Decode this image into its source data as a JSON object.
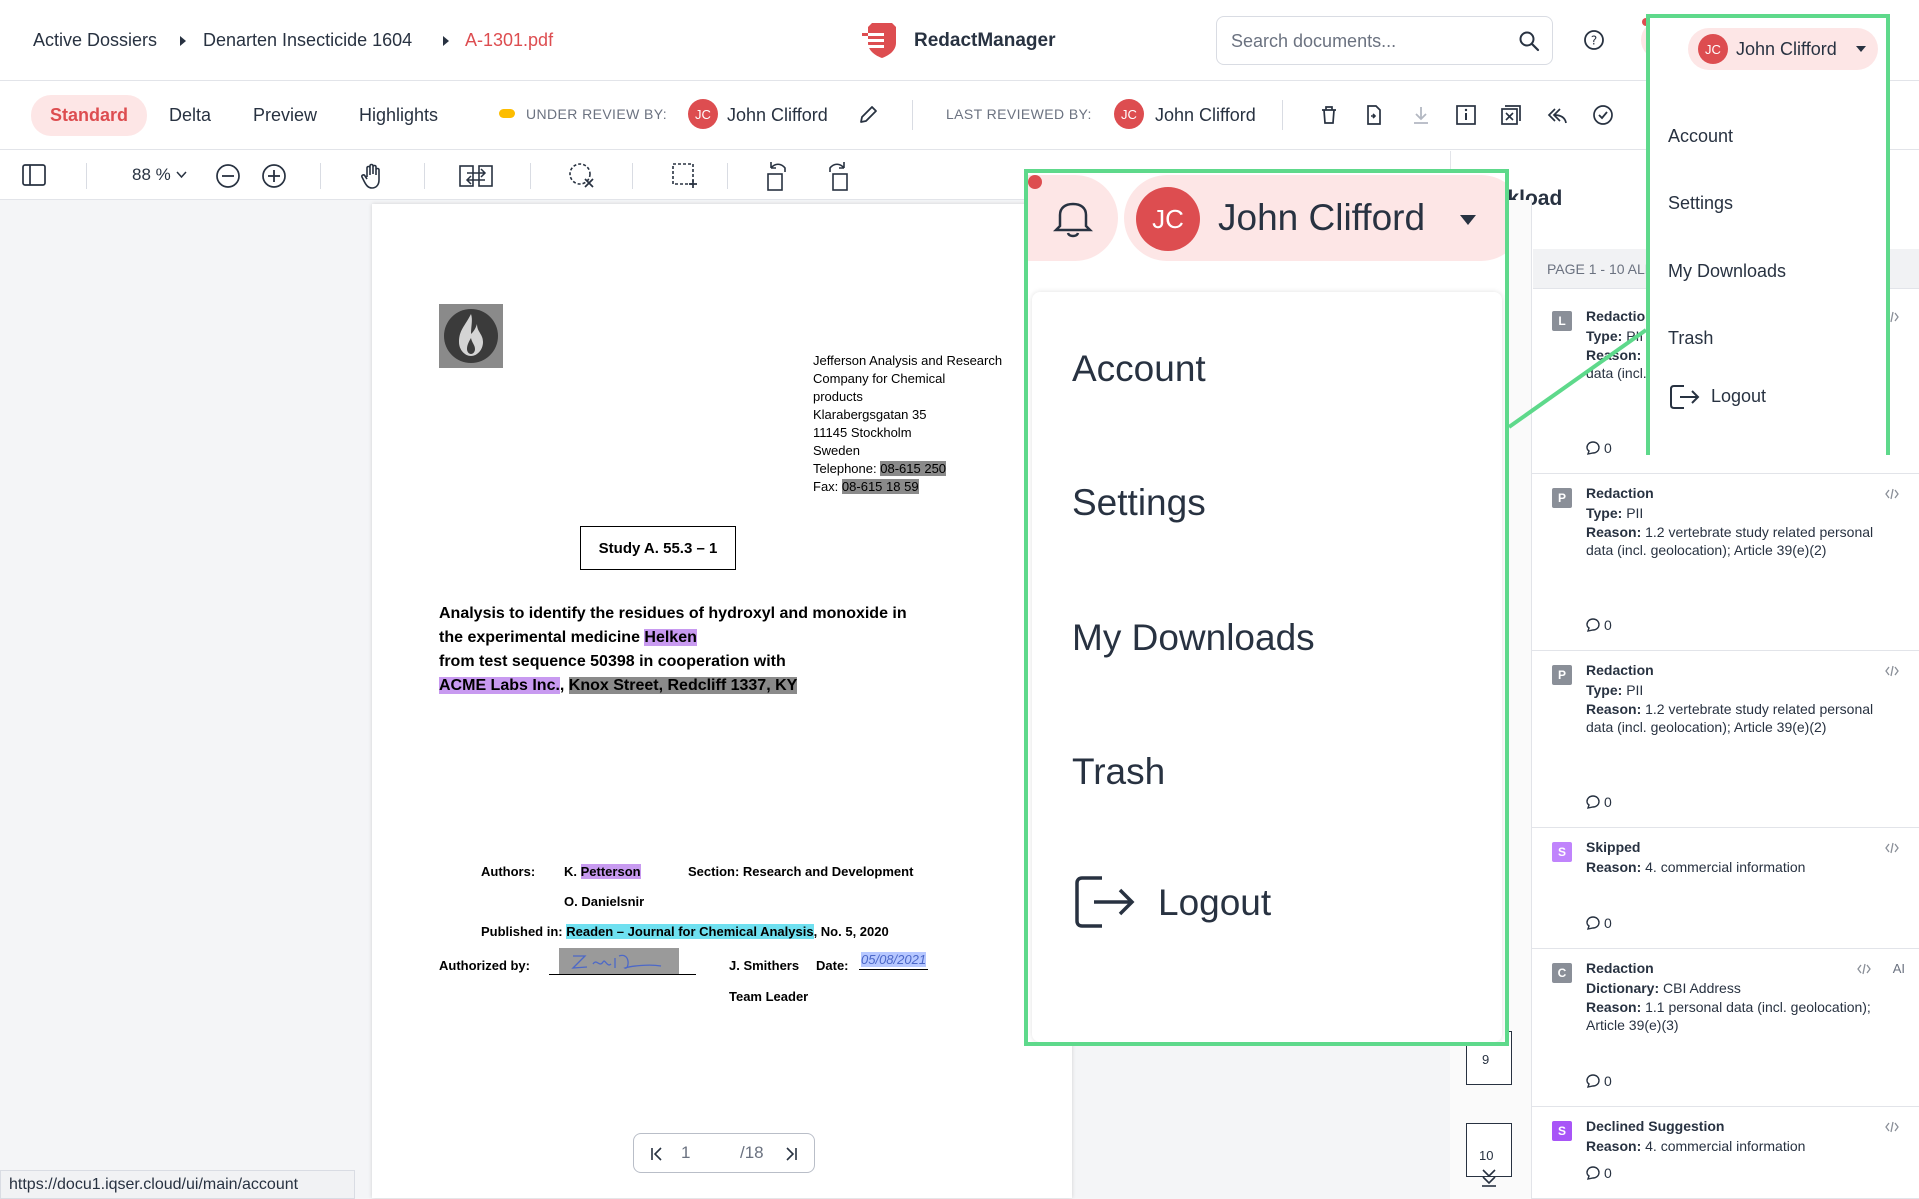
{
  "breadcrumb": {
    "items": [
      "Active Dossiers",
      "Denarten Insecticide 1604",
      "A-1301.pdf"
    ]
  },
  "brand": {
    "name": "RedactManager",
    "color": "#dd4d50"
  },
  "search": {
    "placeholder": "Search documents..."
  },
  "user": {
    "initials": "JC",
    "name": "John Clifford"
  },
  "view_tabs": [
    "Standard",
    "Delta",
    "Preview",
    "Highlights"
  ],
  "review": {
    "under_review_label": "UNDER REVIEW BY:",
    "under_review_name": "John Clifford",
    "last_reviewed_label": "LAST REVIEWED BY:",
    "last_reviewed_name": "John Clifford"
  },
  "toolbar": {
    "zoom": "88 %"
  },
  "document": {
    "address": [
      "Jefferson Analysis and Research",
      "Company for Chemical",
      "products",
      "Klarabergsgatan 35",
      "11145 Stockholm",
      "Sweden"
    ],
    "telephone_label": "Telephone:",
    "telephone_value": "08-615 250",
    "fax_label": "Fax:",
    "fax_value": "08-615 18 59",
    "study_box": "Study A. 55.3 – 1",
    "title_line1": "Analysis to identify the residues of hydroxyl and monoxide in",
    "title_line2_prefix": "the experimental medicine ",
    "title_line2_hl": "Helken",
    "title_line3": "from test sequence 50398 in cooperation with",
    "title_line4_a": "ACME Labs Inc.",
    "title_line4_sep": ", ",
    "title_line4_b": "Knox Street, Redcliff 1337, KY",
    "authors_label": "Authors:",
    "author1_prefix": "K. ",
    "author1_hl": "Petterson",
    "section": "Section: Research and Development",
    "author2": "O. Danielsnir",
    "published_label": "Published in: ",
    "published_hl": "Readen – Journal for Chemical Analysis",
    "published_suffix": ", No. 5, 2020",
    "authorized_label": "Authorized by:",
    "signer": "J. Smithers",
    "date_label": "Date:",
    "date_value": "05/08/2021",
    "team_leader": "Team Leader"
  },
  "pagenav": {
    "current": "1",
    "total": "/18"
  },
  "status_url": "https://docu1.iqser.cloud/ui/main/account",
  "workload": {
    "title": "Workload",
    "page_range": "PAGE 1 - 10 ALL",
    "thumb_pages": [
      "9",
      "10"
    ],
    "annotations": [
      {
        "badge": "L",
        "badge_color": "#8a8f98",
        "title": "Redaction",
        "lines": [
          {
            "k": "Type:",
            "v": " PII"
          },
          {
            "k": "Reason:",
            "v": " 1.2 vertebrate study related personal data (incl. geolocation); Article 39(e)(2)"
          }
        ],
        "comments": "0"
      },
      {
        "badge": "P",
        "badge_color": "#8a8f98",
        "title": "Redaction",
        "lines": [
          {
            "k": "Type:",
            "v": " PII"
          },
          {
            "k": "Reason:",
            "v": " 1.2 vertebrate study related personal data (incl. geolocation); Article 39(e)(2)"
          }
        ],
        "comments": "0"
      },
      {
        "badge": "P",
        "badge_color": "#8a8f98",
        "title": "Redaction",
        "lines": [
          {
            "k": "Type:",
            "v": " PII"
          },
          {
            "k": "Reason:",
            "v": " 1.2 vertebrate study related personal data (incl. geolocation); Article 39(e)(2)"
          }
        ],
        "comments": "0"
      },
      {
        "badge": "S",
        "badge_color": "#c084fc",
        "title": "Skipped",
        "lines": [
          {
            "k": "Reason:",
            "v": " 4. commercial information"
          }
        ],
        "comments": "0"
      },
      {
        "badge": "C",
        "badge_color": "#8a8f98",
        "title": "Redaction",
        "extra": "AI",
        "lines": [
          {
            "k": "Dictionary:",
            "v": " CBI Address"
          },
          {
            "k": "Reason:",
            "v": " 1.1 personal data (incl. geolocation); Article 39(e)(3)"
          }
        ],
        "comments": "0"
      },
      {
        "badge": "S",
        "badge_color": "#a855f7",
        "title": "Declined Suggestion",
        "lines": [
          {
            "k": "Reason:",
            "v": " 4. commercial information"
          }
        ],
        "comments": "0"
      }
    ]
  },
  "user_menu": {
    "items": [
      "Account",
      "Settings",
      "My Downloads",
      "Trash"
    ],
    "logout": "Logout"
  },
  "highlight_color": "#5ed98b"
}
